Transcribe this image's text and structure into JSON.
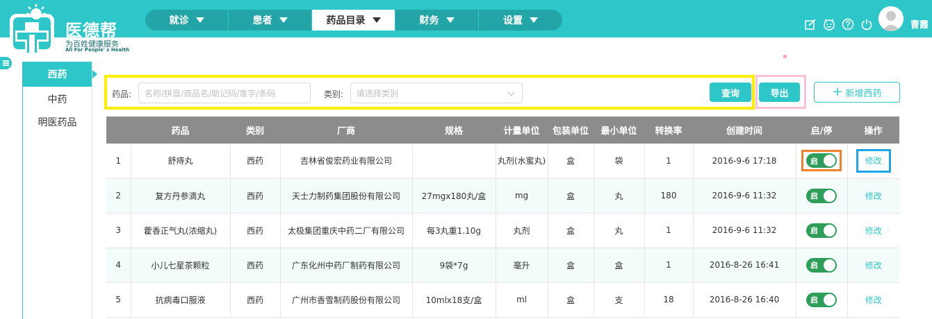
{
  "app": {
    "name": "医德帮",
    "tagline": "为百姓健康服务",
    "tagline_en": "All For People' s Health"
  },
  "nav": {
    "items": [
      {
        "label": "就诊"
      },
      {
        "label": "患者"
      },
      {
        "label": "药品目录",
        "active": true
      },
      {
        "label": "财务"
      },
      {
        "label": "设置"
      }
    ]
  },
  "user": {
    "name": "曹霞"
  },
  "top_icons": [
    "edit-icon",
    "smile-icon",
    "help-icon",
    "power-icon"
  ],
  "sidebar": {
    "items": [
      {
        "label": "西药",
        "active": true
      },
      {
        "label": "中药"
      },
      {
        "label": "明医药品"
      }
    ]
  },
  "search": {
    "drug_label": "药品:",
    "drug_placeholder": "名称/拼音/商品名/助记码/准字/条码",
    "category_label": "类别:",
    "category_placeholder": "请选择类别",
    "query_button": "查询",
    "export_button": "导出",
    "add_button": "新增西药"
  },
  "table": {
    "headers": [
      "",
      "药品",
      "类别",
      "厂商",
      "规格",
      "计量单位",
      "包装单位",
      "最小单位",
      "转换率",
      "创建时间",
      "启/停",
      "操作"
    ],
    "rows": [
      {
        "idx": "1",
        "name": "舒痔丸",
        "category": "西药",
        "maker": "吉林省俊宏药业有限公司",
        "spec": "",
        "unit": "丸剂(水蜜丸)",
        "pack": "盒",
        "min": "袋",
        "rate": "1",
        "created": "2016-9-6 17:18",
        "toggle": "启",
        "action": "修改"
      },
      {
        "idx": "2",
        "name": "复方丹参滴丸",
        "category": "西药",
        "maker": "天士力制药集团股份有限公司",
        "spec": "27mgx180丸/盒",
        "unit": "mg",
        "pack": "盒",
        "min": "丸",
        "rate": "180",
        "created": "2016-9-6 11:32",
        "toggle": "启",
        "action": "修改"
      },
      {
        "idx": "3",
        "name": "藿香正气丸(浓缩丸)",
        "category": "西药",
        "maker": "太极集团重庆中药二厂有限公司",
        "spec": "每3丸重1.10g",
        "unit": "丸剂",
        "pack": "盒",
        "min": "丸",
        "rate": "1",
        "created": "2016-9-6 11:32",
        "toggle": "启",
        "action": "修改"
      },
      {
        "idx": "4",
        "name": "小儿七星茶颗粒",
        "category": "西药",
        "maker": "广东化州中药厂制药有限公司",
        "spec": "9袋*7g",
        "unit": "毫升",
        "pack": "盒",
        "min": "盒",
        "rate": "1",
        "created": "2016-8-26 16:41",
        "toggle": "启",
        "action": "修改"
      },
      {
        "idx": "5",
        "name": "抗病毒口服液",
        "category": "西药",
        "maker": "广州市香雪制药股份有限公司",
        "spec": "10mlx18支/盒",
        "unit": "ml",
        "pack": "盒",
        "min": "支",
        "rate": "18",
        "created": "2016-8-26 16:40",
        "toggle": "启",
        "action": "修改"
      }
    ]
  },
  "colors": {
    "brand": "#2ec7c9",
    "toggle_on": "#2e9e5a",
    "highlight_search": "#ffee00",
    "highlight_export": "#f9c2d9",
    "highlight_toggle": "#f0802a",
    "highlight_edit": "#1ea3e6"
  }
}
